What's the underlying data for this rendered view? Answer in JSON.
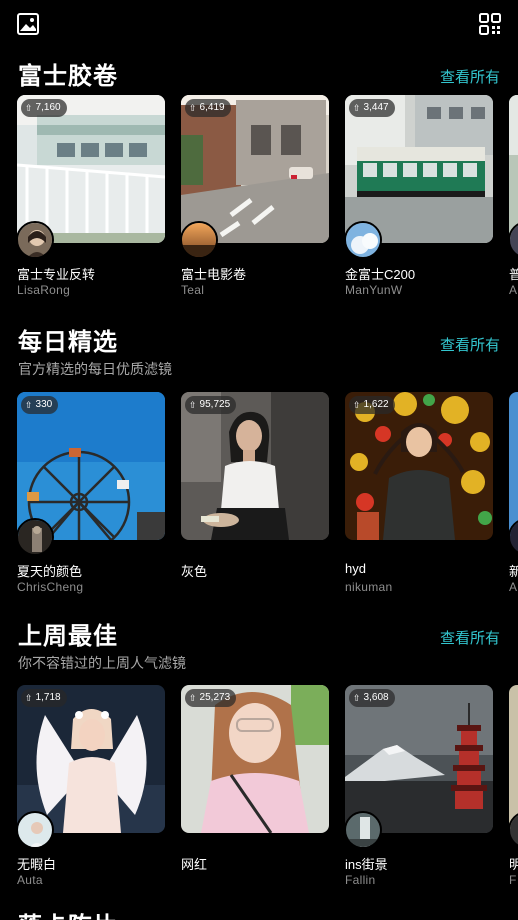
{
  "header": {
    "gallery_icon": "gallery-icon",
    "qr_icon": "qr-code-icon"
  },
  "sections": [
    {
      "title": "富士胶卷",
      "subtitle": "",
      "see_all": "查看所有",
      "cards": [
        {
          "downloads": "7,160",
          "name": "富士专业反转",
          "user": "LisaRong"
        },
        {
          "downloads": "6,419",
          "name": "富士电影卷",
          "user": "Teal"
        },
        {
          "downloads": "3,447",
          "name": "金富士C200",
          "user": "ManYunW"
        },
        {
          "downloads": "",
          "name": "普",
          "user": "A"
        }
      ]
    },
    {
      "title": "每日精选",
      "subtitle": "官方精选的每日优质滤镜",
      "see_all": "查看所有",
      "cards": [
        {
          "downloads": "330",
          "name": "夏天的颜色",
          "user": "ChrisCheng"
        },
        {
          "downloads": "95,725",
          "name": "灰色",
          "user": ""
        },
        {
          "downloads": "1,622",
          "name": "hyd",
          "user": "nikuman"
        },
        {
          "downloads": "",
          "name": "新",
          "user": "A"
        }
      ]
    },
    {
      "title": "上周最佳",
      "subtitle": "你不容错过的上周人气滤镜",
      "see_all": "查看所有",
      "cards": [
        {
          "downloads": "1,718",
          "name": "无暇白",
          "user": "Auta"
        },
        {
          "downloads": "25,273",
          "name": "网红",
          "user": ""
        },
        {
          "downloads": "3,608",
          "name": "ins街景",
          "user": "Fallin"
        },
        {
          "downloads": "",
          "name": "明",
          "user": "F"
        }
      ]
    },
    {
      "title": "落卡陈片",
      "subtitle": "",
      "see_all": ""
    }
  ],
  "colors": {
    "accent": "#33c6cf",
    "background": "#000000",
    "muted": "#8e8e8e"
  }
}
